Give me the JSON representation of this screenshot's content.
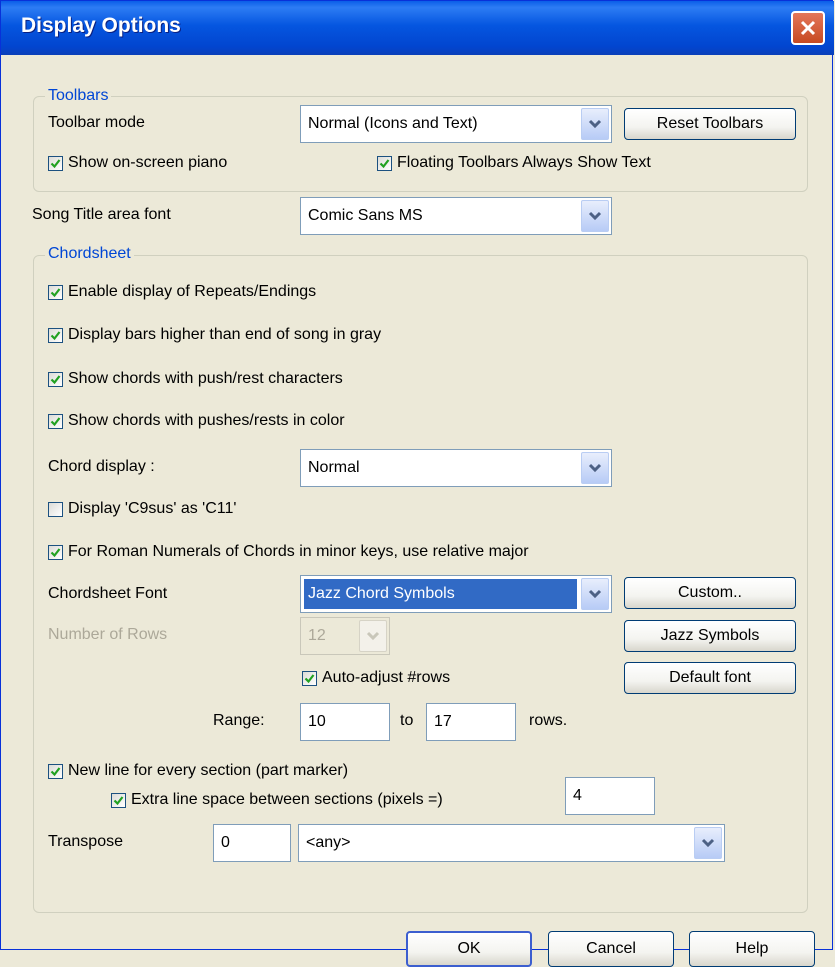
{
  "window": {
    "title": "Display Options"
  },
  "toolbars": {
    "legend": "Toolbars",
    "mode_label": "Toolbar mode",
    "mode_value": "Normal (Icons and Text)",
    "reset_button": "Reset Toolbars",
    "show_piano": {
      "label": "Show on-screen piano",
      "checked": true
    },
    "floating_text": {
      "label": "Floating Toolbars Always Show Text",
      "checked": true
    }
  },
  "song_title": {
    "label": "Song Title area font",
    "value": "Comic Sans MS"
  },
  "chordsheet": {
    "legend": "Chordsheet",
    "repeats": {
      "label": "Enable display of Repeats/Endings",
      "checked": true
    },
    "bars_gray": {
      "label": "Display bars higher than end of song in gray",
      "checked": true
    },
    "push_rest_chars": {
      "label": "Show chords with  push/rest characters",
      "checked": true
    },
    "push_rest_color": {
      "label": "Show chords with pushes/rests in color",
      "checked": true
    },
    "chord_display_label": "Chord display :",
    "chord_display_value": "Normal",
    "c9sus": {
      "label": "Display 'C9sus' as 'C11'",
      "checked": false
    },
    "roman_numerals": {
      "label": "For Roman Numerals of Chords in minor keys, use relative major",
      "checked": true
    },
    "font_label": "Chordsheet Font",
    "font_value": "Jazz Chord Symbols",
    "custom_button": "Custom..",
    "rows_label": "Number of Rows",
    "rows_value": "12",
    "jazz_button": "Jazz Symbols",
    "auto_adjust": {
      "label": "Auto-adjust #rows",
      "checked": true
    },
    "default_font_button": "Default font",
    "range_label": "Range:",
    "range_from": "10",
    "range_to_label": "to",
    "range_to": "17",
    "rows_suffix": "rows.",
    "new_line": {
      "label": "New line for every section (part marker)",
      "checked": true
    },
    "extra_space": {
      "label": "Extra line space between sections (pixels =)",
      "checked": true
    },
    "extra_space_value": "4",
    "transpose_label": "Transpose",
    "transpose_value": "0",
    "transpose_key": "<any>"
  },
  "footer": {
    "ok": "OK",
    "cancel": "Cancel",
    "help": "Help"
  },
  "colors": {
    "titlebar": "#0245cf",
    "accent": "#0046d5",
    "selection": "#316ac5",
    "check": "#21a121",
    "close": "#c74a22"
  }
}
